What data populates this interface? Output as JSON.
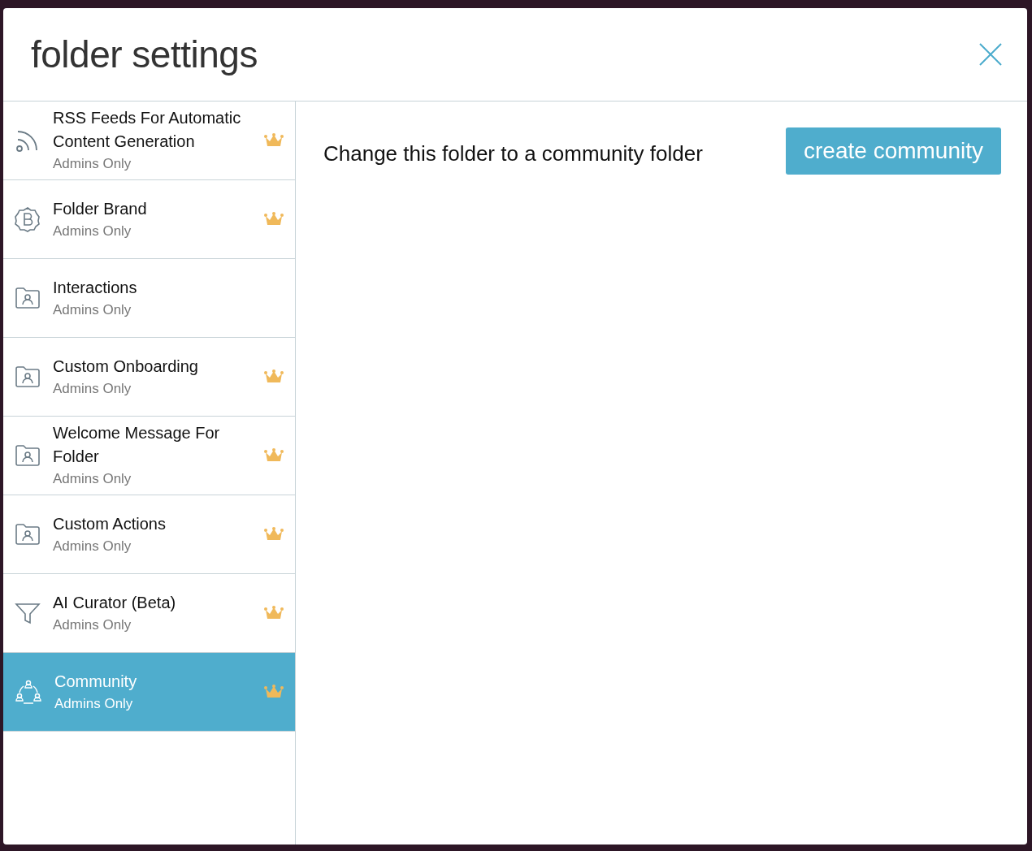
{
  "dialog": {
    "title": "folder settings"
  },
  "sidebar": {
    "items": [
      {
        "title": "RSS Feeds For Automatic Content Generation",
        "subtitle": "Admins Only",
        "kind": "rss",
        "premium": true,
        "selected": false
      },
      {
        "title": "Folder Brand",
        "subtitle": "Admins Only",
        "kind": "brand",
        "premium": true,
        "selected": false
      },
      {
        "title": "Interactions",
        "subtitle": "Admins Only",
        "kind": "folder",
        "premium": false,
        "selected": false
      },
      {
        "title": "Custom Onboarding",
        "subtitle": "Admins Only",
        "kind": "folder",
        "premium": true,
        "selected": false
      },
      {
        "title": "Welcome Message For Folder",
        "subtitle": "Admins Only",
        "kind": "folder",
        "premium": true,
        "selected": false
      },
      {
        "title": "Custom Actions",
        "subtitle": "Admins Only",
        "kind": "folder",
        "premium": true,
        "selected": false
      },
      {
        "title": "AI Curator (Beta)",
        "subtitle": "Admins Only",
        "kind": "filter",
        "premium": true,
        "selected": false
      },
      {
        "title": "Community",
        "subtitle": "Admins Only",
        "kind": "community",
        "premium": true,
        "selected": true
      }
    ]
  },
  "content": {
    "text": "Change this folder to a community folder",
    "button": "create community"
  }
}
